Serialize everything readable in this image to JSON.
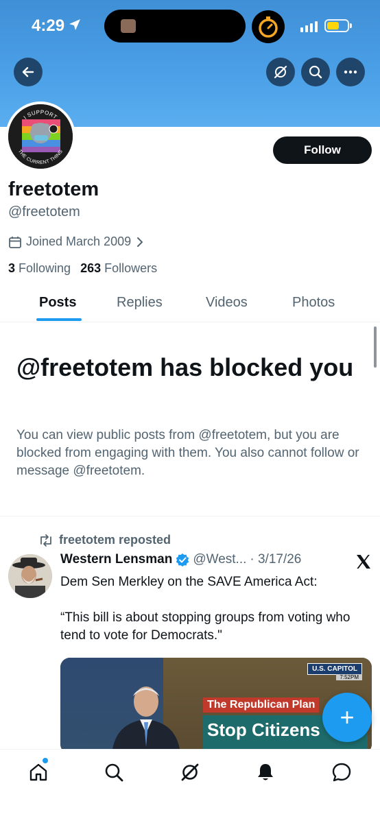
{
  "status_bar": {
    "time": "4:29"
  },
  "header": {
    "back_icon": "arrow-left-icon",
    "grok_icon": "grok-icon",
    "search_icon": "search-icon",
    "more_icon": "more-horizontal-icon"
  },
  "profile": {
    "avatar_badge_top": "I SUPPORT",
    "avatar_badge_bottom": "THE CURRENT THING",
    "display_name": "freetotem",
    "handle": "@freetotem",
    "joined": "Joined March 2009",
    "following_count": "3",
    "following_label": "Following",
    "followers_count": "263",
    "followers_label": "Followers",
    "follow_label": "Follow"
  },
  "tabs": [
    {
      "label": "Posts",
      "active": true
    },
    {
      "label": "Replies",
      "active": false
    },
    {
      "label": "Videos",
      "active": false
    },
    {
      "label": "Photos",
      "active": false
    }
  ],
  "blocked": {
    "title": "@freetotem has blocked you",
    "message": "You can view public posts from @freetotem, but you are blocked from engaging with them. You also cannot follow or message @freetotem."
  },
  "post": {
    "repost_label": "freetotem reposted",
    "author": "Western Lensman",
    "author_handle": "@West...",
    "date": "· 3/17/26",
    "text": "Dem Sen Merkley on the SAVE America Act:\n\n“This bill is about stopping groups from voting who tend to vote for Democrats.\"",
    "media": {
      "network_badge": "U.S. CAPITOL",
      "badge_time": "7:52PM",
      "caption": "The Republican Plan",
      "headline": "Stop Citizens"
    }
  },
  "fab_label": "+",
  "bottom_nav": [
    "home-icon",
    "search-icon",
    "grok-icon",
    "notifications-bell-icon",
    "messages-icon"
  ],
  "colors": {
    "accent": "#1d9bf0",
    "banner": "#4a9fe6",
    "text_secondary": "#536471"
  }
}
